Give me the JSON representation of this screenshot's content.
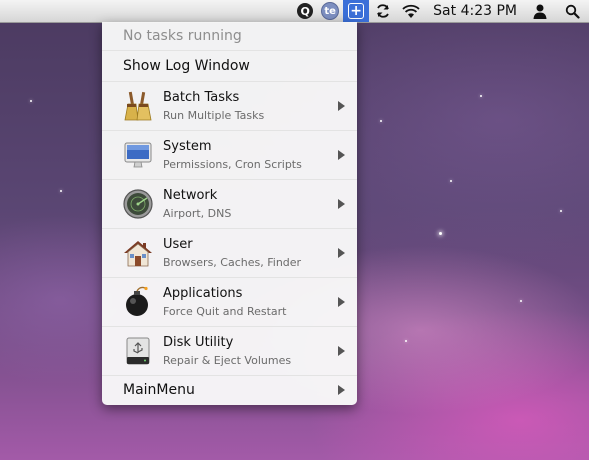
{
  "menubar": {
    "q_icon_label": "Q",
    "te_icon_label": "te",
    "plus_icon_label": "+",
    "clock": "Sat 4:23 PM",
    "active_color": "#3b6fd8"
  },
  "menu": {
    "status": "No tasks running",
    "log": "Show Log Window",
    "items": [
      {
        "title": "Batch Tasks",
        "subtitle": "Run Multiple Tasks",
        "icon": "broom-icon"
      },
      {
        "title": "System",
        "subtitle": "Permissions, Cron Scripts",
        "icon": "monitor-icon"
      },
      {
        "title": "Network",
        "subtitle": "Airport, DNS",
        "icon": "radar-icon"
      },
      {
        "title": "User",
        "subtitle": "Browsers, Caches, Finder",
        "icon": "house-icon"
      },
      {
        "title": "Applications",
        "subtitle": "Force Quit and Restart",
        "icon": "bomb-icon"
      },
      {
        "title": "Disk Utility",
        "subtitle": "Repair & Eject Volumes",
        "icon": "disk-icon"
      }
    ],
    "main": "MainMenu"
  }
}
